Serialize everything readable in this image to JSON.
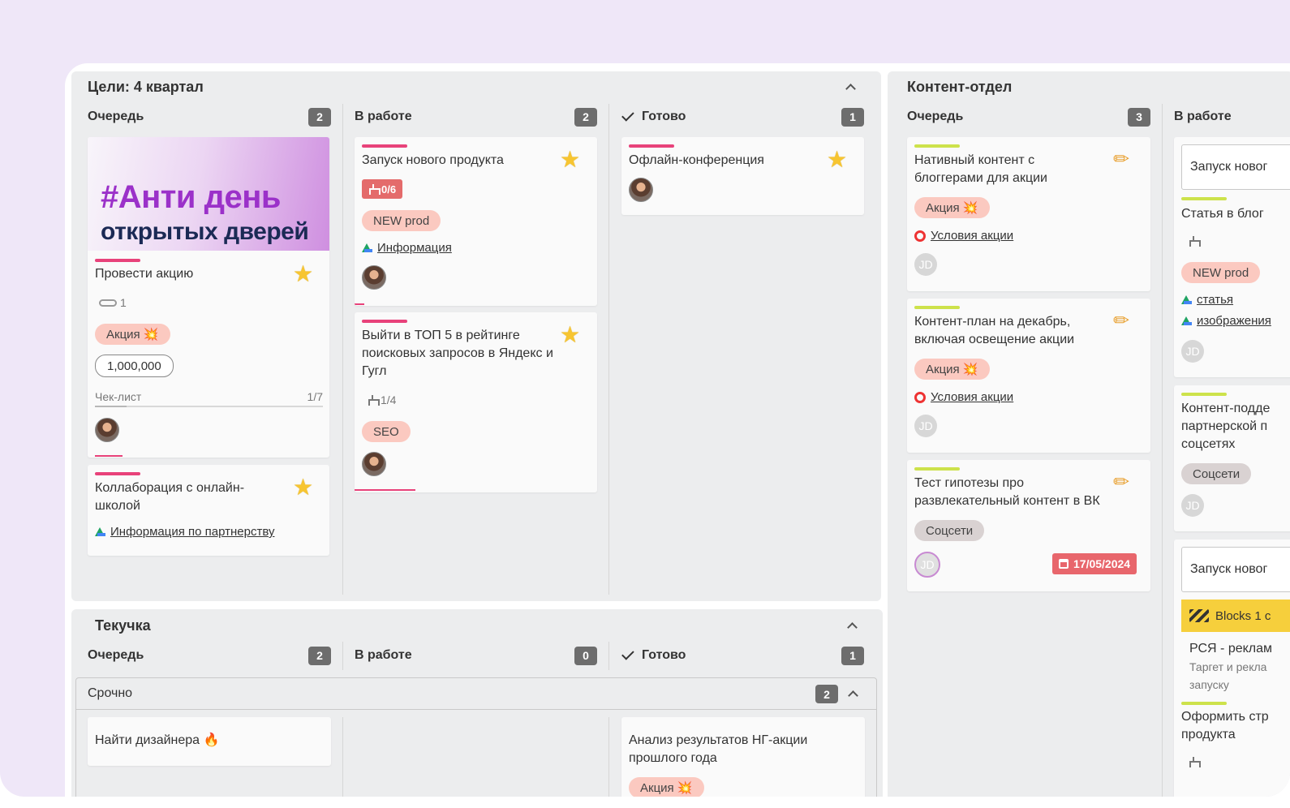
{
  "colors": {
    "accent": "#e8427a",
    "lime": "#cde24b",
    "badge": "#6d6d6d",
    "tag": "#fbc9c0",
    "background": "#efe7f8"
  },
  "goals": {
    "title": "Цели: 4 квартал",
    "columns": [
      {
        "name": "Очередь",
        "count": "2"
      },
      {
        "name": "В работе",
        "count": "2"
      },
      {
        "name": "Готово",
        "count": "1"
      }
    ],
    "cards": {
      "promo": {
        "banner_line1": "#Анти день",
        "banner_line2": "открытых дверей",
        "title": "Провести акцию",
        "attachments": "1",
        "tag": "Акция 💥",
        "amount": "1,000,000",
        "checklist_label": "Чек-лист",
        "checklist_progress": "1/7",
        "checklist_fraction": 0.14
      },
      "collab": {
        "title": "Коллаборация с онлайн-школой",
        "link": "Информация по партнерству"
      },
      "launch": {
        "title": "Запуск нового продукта",
        "subtasks": "0/6",
        "tag": "NEW prod",
        "link": "Информация"
      },
      "top5": {
        "title": "Выйти в ТОП 5 в рейтинге поисковых запросов в Яндекс и Гугл",
        "subtasks": "1/4",
        "tag": "SEO"
      },
      "offline": {
        "title": "Офлайн-конференция"
      }
    }
  },
  "content": {
    "title": "Контент-отдел",
    "columns": [
      {
        "name": "Очередь",
        "count": "3"
      },
      {
        "name": "В работе"
      }
    ],
    "cards": {
      "native": {
        "title": "Нативный контент с блоггерами для акции",
        "tag": "Акция 💥",
        "link": "Условия акции",
        "avatar": "JD"
      },
      "plan": {
        "title": "Контент-план на декабрь, включая освещение акции",
        "tag": "Акция 💥",
        "link": "Условия акции",
        "avatar": "JD"
      },
      "test": {
        "title": "Тест гипотезы про развлекательный контент в ВК",
        "tag": "Соцсети",
        "avatar": "JD",
        "date": "17/05/2024"
      },
      "launch_input": "Запуск новог",
      "blog": {
        "title": "Статья в блог",
        "tag": "NEW prod",
        "link1": "статья",
        "link2": "изображения",
        "avatar": "JD"
      },
      "partner": {
        "title_line1": "Контент-подде",
        "title_line2": "партнерской п",
        "title_line3": "соцсетях",
        "tag": "Соцсети",
        "avatar": "JD"
      },
      "launch_input2": "Запуск новог",
      "blocks": "Blocks 1 c",
      "rsya": {
        "title": "РСЯ - реклам",
        "subtitle_line1": "Таргет и рекла",
        "subtitle_line2": "запуску"
      },
      "page": {
        "title_line1": "Оформить стр",
        "title_line2": "продукта"
      }
    }
  },
  "turnover": {
    "title": "Текучка",
    "columns": [
      {
        "name": "Очередь",
        "count": "2"
      },
      {
        "name": "В работе",
        "count": "0"
      },
      {
        "name": "Готово",
        "count": "1"
      }
    ],
    "swimlane": {
      "title": "Срочно",
      "count": "2"
    },
    "cards": {
      "designer": {
        "title": "Найти дизайнера 🔥"
      },
      "analysis": {
        "title": "Анализ результатов НГ-акции прошлого года",
        "tag": "Акция 💥"
      }
    }
  }
}
